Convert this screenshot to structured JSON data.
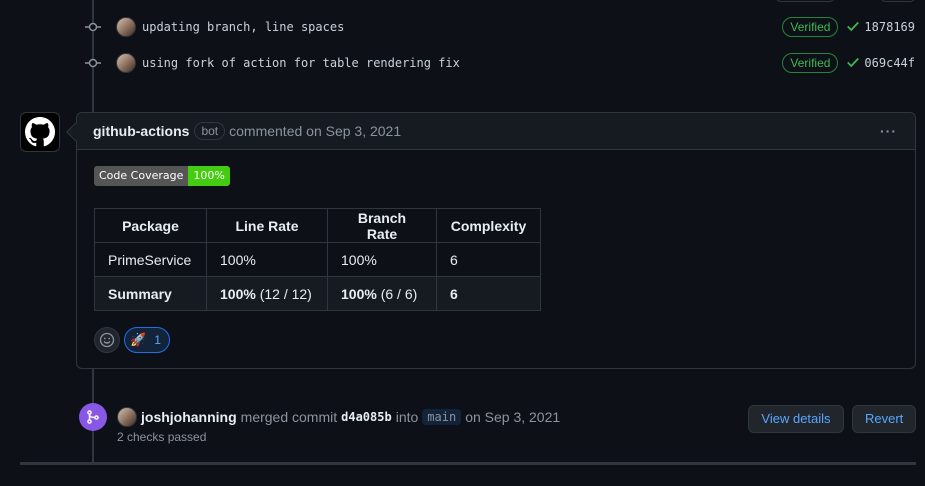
{
  "commits": [
    {
      "message": "updating branch, line spaces",
      "verified": "Verified",
      "sha": "1878169"
    },
    {
      "message": "using fork of action for table rendering fix",
      "verified": "Verified",
      "sha": "069c44f"
    }
  ],
  "comment": {
    "author": "github-actions",
    "badge": "bot",
    "action_text": "commented on Sep 3, 2021",
    "menu_icon": "kebab-horizontal-icon",
    "coverage_badge": {
      "label": "Code Coverage",
      "value": "100%"
    },
    "table": {
      "headers": [
        "Package",
        "Line Rate",
        "Branch Rate",
        "Complexity"
      ],
      "rows": [
        [
          "PrimeService",
          "100%",
          "100%",
          "6"
        ]
      ],
      "summary": {
        "label": "Summary",
        "line_rate_bold": "100%",
        "line_rate_rest": " (12 / 12)",
        "branch_rate_bold": "100%",
        "branch_rate_rest": " (6 / 6)",
        "complexity": "6"
      }
    },
    "reactions": {
      "add_icon": "smiley-icon",
      "rocket_emoji": "🚀",
      "rocket_count": "1"
    }
  },
  "merge": {
    "author": "joshjohanning",
    "text1": "merged commit",
    "sha": "d4a085b",
    "text2": "into",
    "branch": "main",
    "date": "on Sep 3, 2021",
    "checks": "2 checks passed",
    "view_details": "View details",
    "revert": "Revert"
  },
  "colors": {
    "verified": "#3fb950",
    "link": "#58a6ff",
    "merge_purple": "#8957e5",
    "badge_green": "#44cc11"
  }
}
